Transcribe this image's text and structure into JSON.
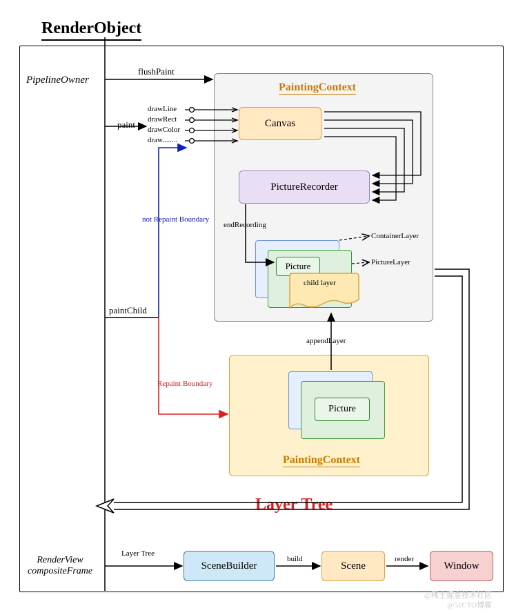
{
  "title": "RenderObject",
  "actors": {
    "pipeline_owner": "PipelineOwner",
    "renderview_composite": "RenderView\ncompositeFrame"
  },
  "arrows": {
    "flushPaint": "flushPaint",
    "paint": "paint",
    "paintChild": "paintChild",
    "not_repaint": "not Repaint Boundary",
    "repaint": "Repaint Boundary",
    "appendLayer": "appendLayer",
    "endRecording": "endRecording",
    "layer_tree_big": "Layer Tree",
    "layer_tree_small": "Layer Tree",
    "build": "build",
    "render": "render"
  },
  "draw_ops": [
    "drawLine",
    "drawRect",
    "drawColor",
    "draw........"
  ],
  "boxes": {
    "painting_context_1": "PaintingContext",
    "canvas": "Canvas",
    "picture_recorder": "PictureRecorder",
    "picture_1": "Picture",
    "child_layer": "child layer",
    "container_layer": "ContainerLayer",
    "picture_layer": "PictureLayer",
    "painting_context_2": "PaintingContext",
    "picture_2": "Picture",
    "scene_builder": "SceneBuilder",
    "scene": "Scene",
    "window": "Window"
  },
  "watermark1": "@稀土掘金技术社区",
  "watermark2": "@51CTO博客"
}
